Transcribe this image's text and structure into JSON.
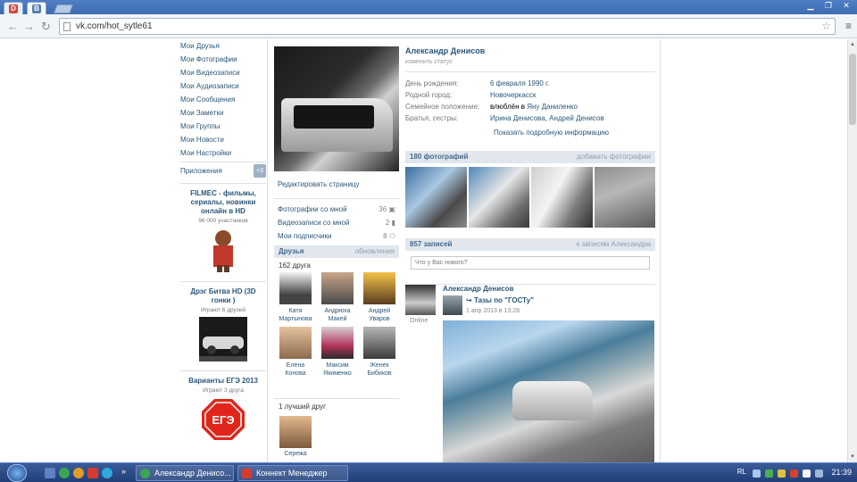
{
  "browser": {
    "tabs": [
      {
        "icon": "D",
        "color": "#d8433b"
      },
      {
        "icon": "B",
        "color": "#5b7fa6"
      }
    ],
    "url": "vk.com/hot_sytle61"
  },
  "left_menu": {
    "items": [
      "Мои Друзья",
      "Мои Фотографии",
      "Мои Видеозаписи",
      "Мои Аудиозаписи",
      "Мои Сообщения",
      "Мои Заметки",
      "Мои Группы",
      "Мои Новости",
      "Мои Настройки"
    ],
    "apps_label": "Приложения",
    "apps_badge": "+3"
  },
  "ads": [
    {
      "title": "FILMEC - фильмы, сериалы, новинки онлайн в HD",
      "sub": "96 000 участников"
    },
    {
      "title": "Дрэг Битва HD (3D гонки )",
      "sub": "Играют 6 друзей"
    },
    {
      "title": "Варианты ЕГЭ 2013",
      "sub": "Играют 3 друга",
      "badge_text": "ЕГЭ"
    }
  ],
  "profile": {
    "edit_link": "Редактировать страницу",
    "counters": [
      {
        "label": "Фотографии со мной",
        "value": "36"
      },
      {
        "label": "Видеозаписи со мной",
        "value": "2"
      },
      {
        "label": "Мои подписчики",
        "value": "8"
      }
    ],
    "friends_header": "Друзья",
    "friends_updates": "обновления",
    "friends_count": "162 друга",
    "friends": [
      {
        "first": "Катя",
        "last": "Мартынова"
      },
      {
        "first": "Андрюха",
        "last": "Макей"
      },
      {
        "first": "Андрей",
        "last": "Уваров"
      },
      {
        "first": "Елена",
        "last": "Конова"
      },
      {
        "first": "Максим",
        "last": "Якименко"
      },
      {
        "first": "Женек",
        "last": "Бибиков"
      }
    ],
    "best_friend_header": "1 лучший друг",
    "best_friend_name": "Сережа",
    "name": "Александр Денисов",
    "status": "изменить статус",
    "info": [
      {
        "k": "День рождения:",
        "v": "6 февраля 1990 г."
      },
      {
        "k": "Родной город:",
        "v": "Новочеркасск"
      },
      {
        "k": "Семейное положение:",
        "v_plain": "влюблён в",
        "v": "Яну Даниленко"
      },
      {
        "k": "Братья, сестры:",
        "v": "Ирина Денисова, Андрей Денисов"
      }
    ],
    "more_info": "Показать подробную информацию",
    "photos_header": "180 фотографий",
    "photos_add": "добавить фотографии",
    "wall_header": "857 записей",
    "wall_link": "к записям Александра",
    "wall_placeholder": "Что у Вас нового?",
    "post": {
      "author": "Александр Денисов",
      "online": "Online",
      "group": "Тазы по \"ГОСТу\"",
      "date": "1 апр 2013 в 13:28"
    }
  },
  "taskbar": {
    "tasks": [
      "Александр Денисо...",
      "Коннект Менеджер"
    ],
    "lang": "RL",
    "time": "21:39"
  }
}
